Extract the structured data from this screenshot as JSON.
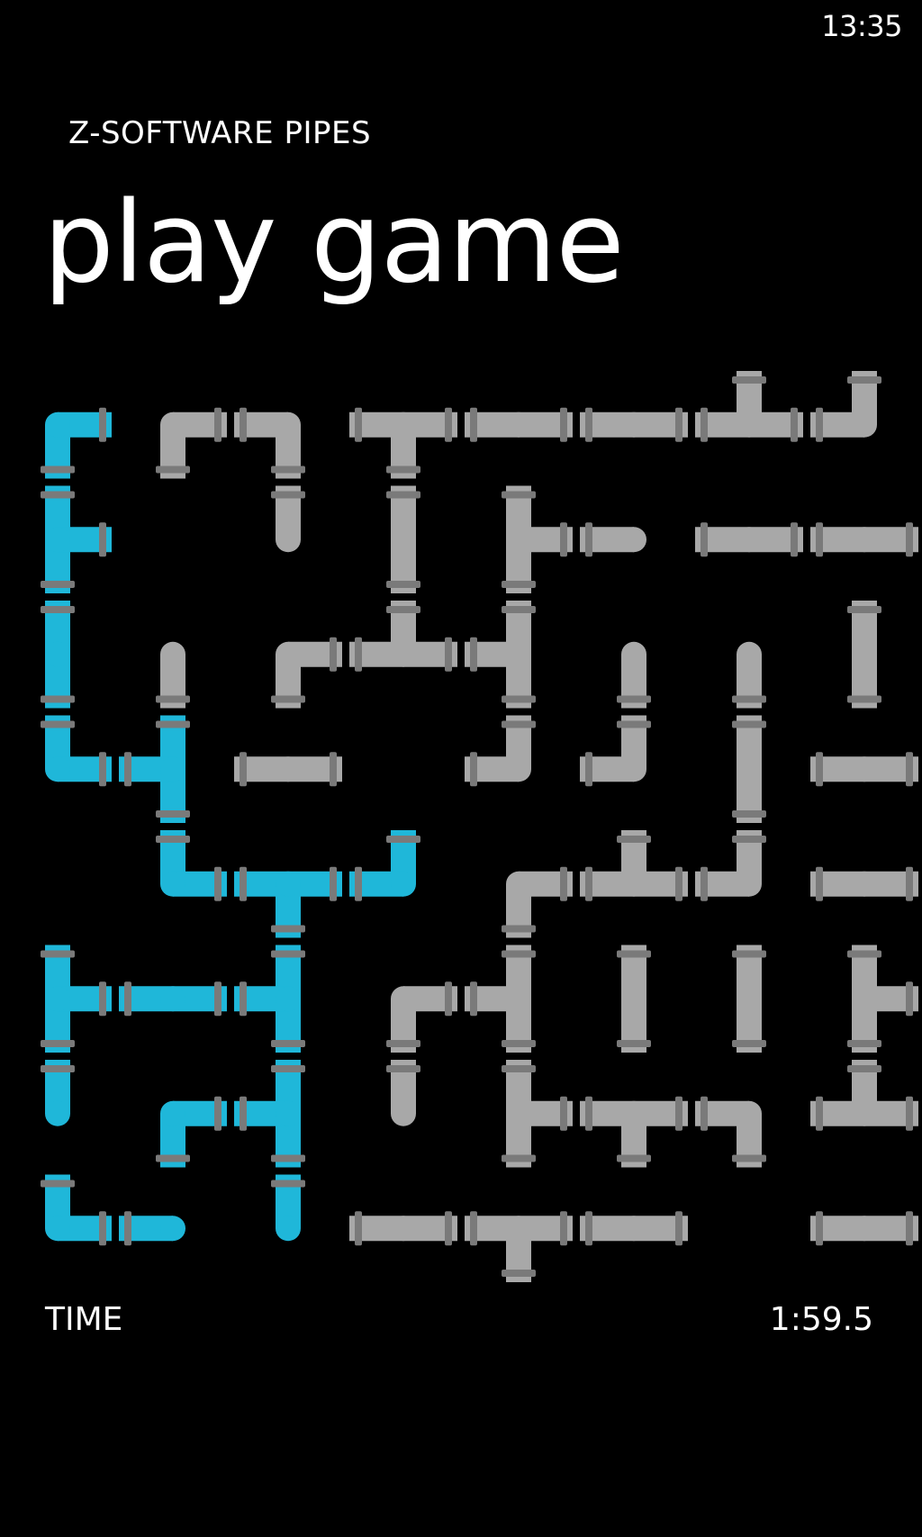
{
  "status": {
    "time": "13:35"
  },
  "app": {
    "title": "Z-SOFTWARE PIPES"
  },
  "page": {
    "title": "play game"
  },
  "footer": {
    "time_label": "TIME",
    "time_value": "1:59.5"
  },
  "colors": {
    "background": "#000000",
    "water": "#1fb7d9",
    "pipe": "#a8a8a8",
    "flange": "#7a7a7a"
  },
  "board": {
    "rows": 8,
    "cols": 8,
    "tiles": [
      [
        "B:ES:w",
        "G:ES:f",
        "G:WS:f",
        "G:EWS:f",
        "G:EW:f",
        "G:EW:f",
        "G:EWN:f",
        "G:WN:f"
      ],
      [
        "B:NSE:w",
        "G:none:f",
        "G:N:f",
        "G:NS:f",
        "G:NES:f",
        "G:W:f",
        "G:EW:f",
        "G:EW:f"
      ],
      [
        "B:NS:w",
        "G:S:f",
        "G:ES:f",
        "G:EWN:f",
        "G:WNS:f",
        "G:S:f",
        "G:S:f",
        "G:NS:f"
      ],
      [
        "B:NE:w",
        "B:NSW:w",
        "G:EW:f",
        "G:none:f",
        "G:NW:f",
        "G:NW:f",
        "G:NS:f",
        "G:EW:f"
      ],
      [
        "G:none:f",
        "B:NE:w",
        "B:EWS:w",
        "B:NW:w",
        "G:ES:f",
        "G:EWN:f",
        "G:NW:f",
        "G:EW:f"
      ],
      [
        "B:NSE:w",
        "B:EW:w",
        "B:NSW:w",
        "G:ES:f",
        "G:NSW:f",
        "G:NS:f",
        "G:NS:f",
        "G:NSE:f"
      ],
      [
        "B:N:w",
        "B:ES:w",
        "B:NSW:w",
        "G:N:f",
        "G:NSE:f",
        "G:EWS:f",
        "G:WS:f",
        "G:EWN:f"
      ],
      [
        "B:EN:w",
        "B:W:w",
        "B:N:w",
        "G:EW:f",
        "G:EWS:f",
        "G:EW:f",
        "G:none:f",
        "G:EW:f"
      ]
    ]
  }
}
